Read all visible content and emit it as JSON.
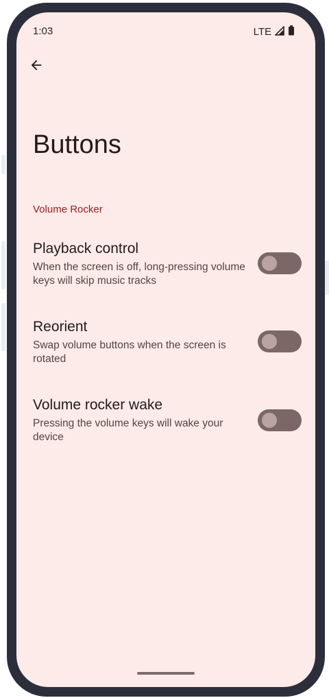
{
  "status_bar": {
    "time": "1:03",
    "network": "LTE",
    "icons": [
      "signal-icon",
      "battery-icon"
    ]
  },
  "toolbar": {
    "back_icon": "arrow-back-icon"
  },
  "page": {
    "title": "Buttons"
  },
  "section": {
    "header": "Volume Rocker"
  },
  "preferences": [
    {
      "title": "Playback control",
      "summary": "When the screen is off, long-pressing volume keys will skip music tracks",
      "enabled": false
    },
    {
      "title": "Reorient",
      "summary": "Swap volume buttons when the screen is rotated",
      "enabled": false
    },
    {
      "title": "Volume rocker wake",
      "summary": "Pressing the volume keys will wake your device",
      "enabled": false
    }
  ],
  "colors": {
    "background": "#fcebe8",
    "accent": "#9c1d25",
    "switch_track_off": "#7b6866",
    "device_frame": "#2c2f3b"
  }
}
